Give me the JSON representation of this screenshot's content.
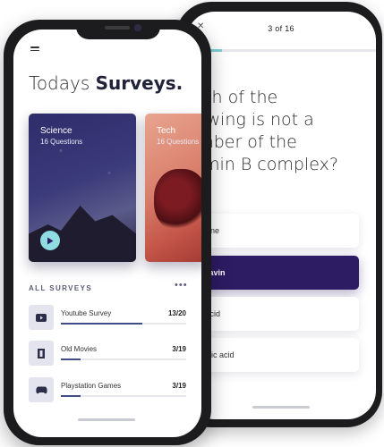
{
  "question_screen": {
    "counter": "3 of 16",
    "progress": 0.19,
    "close_icon": "close-icon",
    "question_lines": [
      "Which of the",
      "following is not a",
      "member of the",
      "Vitamin B complex?"
    ],
    "options": [
      {
        "label": "Thiamine",
        "selected": false
      },
      {
        "label": "Riboflavin",
        "selected": true
      },
      {
        "label": "Folic acid",
        "selected": false
      },
      {
        "label": "Ascorbic acid",
        "selected": false
      }
    ],
    "accent_color": "#2d1b63",
    "progress_color": "#7fcfd6"
  },
  "survey_screen": {
    "menu_icon": "menu-icon",
    "title_light": "Todays ",
    "title_bold": "Surveys.",
    "highlight_color": "#8fdde2",
    "cards": [
      {
        "title": "Science",
        "subtitle": "16 Questions",
        "icon": "play-icon"
      },
      {
        "title": "Tech",
        "subtitle": "16 Questions"
      }
    ],
    "section_label": "ALL SURVEYS",
    "more_icon": "more-icon",
    "more_glyph": "•••",
    "surveys": [
      {
        "name": "Youtube Survey",
        "count": "13/20",
        "progress": 0.65,
        "icon": "youtube-icon"
      },
      {
        "name": "Old Movies",
        "count": "3/19",
        "progress": 0.16,
        "icon": "film-icon"
      },
      {
        "name": "Playstation Games",
        "count": "3/19",
        "progress": 0.16,
        "icon": "gamepad-icon"
      }
    ],
    "fill_color": "#3f4e86"
  }
}
